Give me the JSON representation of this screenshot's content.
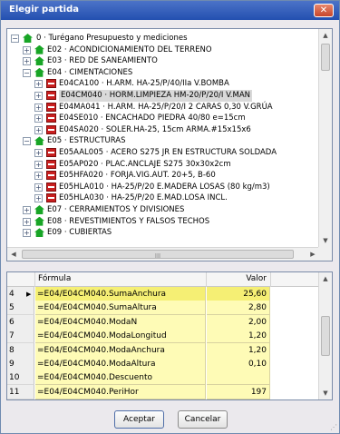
{
  "window": {
    "title": "Elegir partida",
    "close_label": "✕"
  },
  "tree": {
    "root": {
      "label": "0 · Turégano Presupuesto y mediciones",
      "expander": "−"
    },
    "nodes": [
      {
        "label": "E02 · ACONDICIONAMIENTO DEL TERRENO",
        "expander": "+",
        "kind": "chapter"
      },
      {
        "label": "E03 · RED DE SANEAMIENTO",
        "expander": "+",
        "kind": "chapter"
      },
      {
        "label": "E04 · CIMENTACIONES",
        "expander": "−",
        "kind": "chapter"
      },
      {
        "label": "E04CA100 · H.ARM. HA-25/P/40/IIa V.BOMBA",
        "expander": "+",
        "kind": "item"
      },
      {
        "label": "E04CM040 · HORM.LIMPIEZA HM-20/P/20/I V.MAN",
        "expander": "+",
        "kind": "item",
        "selected": true
      },
      {
        "label": "E04MA041 · H.ARM. HA-25/P/20/I 2 CARAS 0,30 V.GRÚA",
        "expander": "+",
        "kind": "item"
      },
      {
        "label": "E04SE010 · ENCACHADO PIEDRA 40/80 e=15cm",
        "expander": "+",
        "kind": "item"
      },
      {
        "label": "E04SA020 · SOLER.HA-25, 15cm ARMA.#15x15x6",
        "expander": "+",
        "kind": "item"
      },
      {
        "label": "E05 · ESTRUCTURAS",
        "expander": "−",
        "kind": "chapter"
      },
      {
        "label": "E05AAL005 · ACERO S275 JR EN ESTRUCTURA SOLDADA",
        "expander": "+",
        "kind": "item"
      },
      {
        "label": "E05AP020 · PLAC.ANCLAJE S275 30x30x2cm",
        "expander": "+",
        "kind": "item"
      },
      {
        "label": "E05HFA020 · FORJA.VIG.AUT. 20+5, B-60",
        "expander": "+",
        "kind": "item"
      },
      {
        "label": "E05HLA010 · HA-25/P/20 E.MADERA LOSAS (80 kg/m3)",
        "expander": "+",
        "kind": "item"
      },
      {
        "label": "E05HLA030 · HA-25/P/20 E.MAD.LOSA INCL.",
        "expander": "+",
        "kind": "item"
      },
      {
        "label": "E07 · CERRAMIENTOS Y DIVISIONES",
        "expander": "+",
        "kind": "chapter"
      },
      {
        "label": "E08 · REVESTIMIENTOS Y FALSOS TECHOS",
        "expander": "+",
        "kind": "chapter"
      },
      {
        "label": "E09 · CUBIERTAS",
        "expander": "+",
        "kind": "chapter"
      }
    ],
    "hscroll_grip": "III"
  },
  "grid": {
    "headers": {
      "formula": "Fórmula",
      "value": "Valor"
    },
    "rows": [
      {
        "num": "4",
        "formula": "=E04/E04CM040.SumaAnchura",
        "value": "25,60",
        "active": true
      },
      {
        "num": "5",
        "formula": "=E04/E04CM040.SumaAltura",
        "value": "2,80"
      },
      {
        "num": "6",
        "formula": "=E04/E04CM040.ModaN",
        "value": "2,00"
      },
      {
        "num": "7",
        "formula": "=E04/E04CM040.ModaLongitud",
        "value": "1,20"
      },
      {
        "num": "8",
        "formula": "=E04/E04CM040.ModaAnchura",
        "value": "1,20"
      },
      {
        "num": "9",
        "formula": "=E04/E04CM040.ModaAltura",
        "value": "0,10"
      },
      {
        "num": "10",
        "formula": "=E04/E04CM040.Descuento",
        "value": ""
      },
      {
        "num": "11",
        "formula": "=E04/E04CM040.PeriHor",
        "value": "197"
      }
    ]
  },
  "buttons": {
    "accept": "Aceptar",
    "cancel": "Cancelar"
  },
  "colors": {
    "titlebar": "#2a57b5",
    "grid_cell": "#fefbb6",
    "grid_cell_active": "#f5ef74",
    "chapter_icon": "#18a526",
    "item_icon": "#c91f1f"
  }
}
